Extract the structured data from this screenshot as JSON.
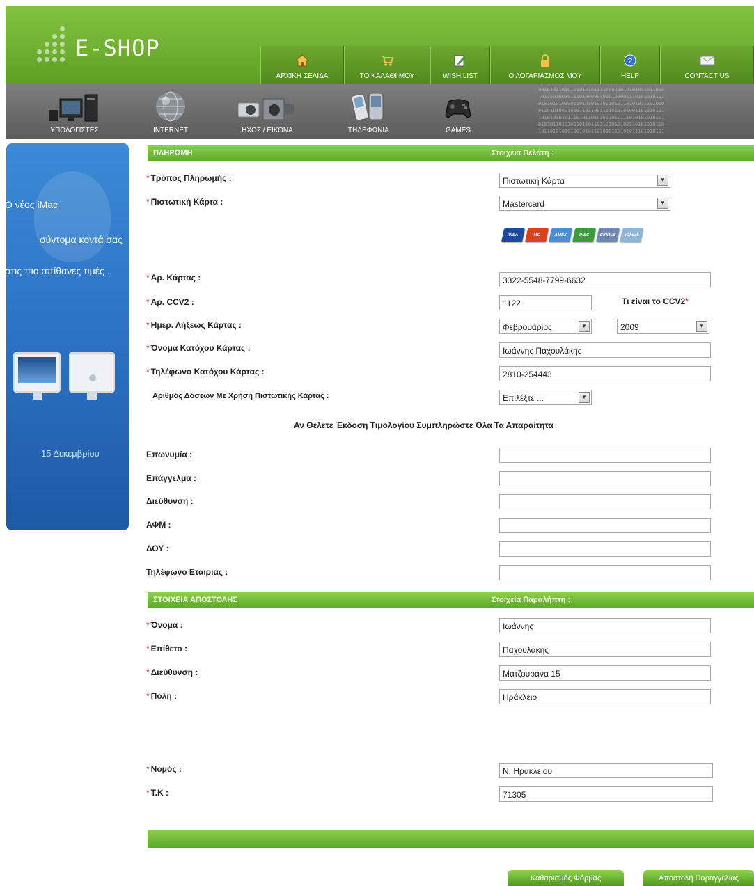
{
  "logo": {
    "text": "E-SHOP"
  },
  "top_nav": [
    {
      "label": "ΑΡΧΙΚΗ ΣΕΛΙΔΑ",
      "icon": "home-icon"
    },
    {
      "label": "ΤΟ ΚΑΛΑΘΙ ΜΟΥ",
      "icon": "cart-icon"
    },
    {
      "label": "WISH LIST",
      "icon": "edit-icon"
    },
    {
      "label": "Ο ΛΟΓΑΡΙΑΣΜΟΣ ΜΟΥ",
      "icon": "lock-icon"
    },
    {
      "label": "HELP",
      "icon": "help-icon"
    },
    {
      "label": "CONTACT US",
      "icon": "envelope-icon"
    }
  ],
  "categories": [
    {
      "label": "ΥΠΟΛΟΓΙΣΤΕΣ",
      "icon": "computer-icon"
    },
    {
      "label": "INTERNET",
      "icon": "globe-icon"
    },
    {
      "label": "ΗΧΟΣ / ΕΙΚΟΝΑ",
      "icon": "camera-icon"
    },
    {
      "label": "ΤΗΛΕΦΩΝΙΑ",
      "icon": "phone-icon"
    },
    {
      "label": "GAMES",
      "icon": "gamepad-icon"
    }
  ],
  "banner": {
    "line1": "Ο νέος iMac",
    "line2": "σύντομα κοντά σας",
    "line3": "στις πιο απίθανες τιμές .",
    "date": "15 Δεκεμβρίου"
  },
  "payment_section": {
    "title": "ΠΛΗΡΩΜΗ",
    "subtitle": "Στοιχεία Πελάτη :",
    "method_label": "Τρόπος Πληρωμής :",
    "method_value": "Πιστωτική Κάρτα",
    "card_label": "Πιστωτική Κάρτα :",
    "card_value": "Mastercard",
    "card_logos": [
      "VISA",
      "MC",
      "AMEX",
      "DISC",
      "CIRRUS",
      "eCheck"
    ],
    "card_number_label": "Αρ. Κάρτας :",
    "card_number_value": "3322-5548-7799-6632",
    "ccv_label": "Αρ. CCV2 :",
    "ccv_value": "1122",
    "ccv_help": "Τι είναι το CCV2",
    "expiry_label": "Ημερ. Λήξεως Κάρτας :",
    "expiry_month": "Φεβρουάριος",
    "expiry_year": "2009",
    "holder_name_label": "Όνομα Κατόχου Κάρτας :",
    "holder_name_value": "Ιωάννης Παχουλάκης",
    "holder_phone_label": "Τηλέφωνο Κατόχου Κάρτας :",
    "holder_phone_value": "2810-254443",
    "installments_label": "Αριθμός Δόσεων Με Χρήση Πιστωτικής Κάρτας :",
    "installments_value": "Επιλέξτε ..."
  },
  "invoice": {
    "note": "Αν Θέλετε Έκδοση Τιμολογίου Συμπληρώστε Όλα Τα Απαραίτητα",
    "company_label": "Επωνυμία :",
    "profession_label": "Επάγγελμα :",
    "address_label": "Διεύθυνση :",
    "vat_label": "ΑΦΜ :",
    "tax_office_label": "ΔΟΥ :",
    "phone_label": "Τηλέφωνο Εταιρίας :"
  },
  "shipping_section": {
    "title": "ΣΤΟΙΧΕΙΑ ΑΠΟΣΤΟΛΗΣ",
    "subtitle": "Στοιχεία Παραλήπτη :",
    "first_name_label": "Όνομα :",
    "first_name_value": "Ιωάννης",
    "last_name_label": "Επίθετο :",
    "last_name_value": "Παχουλάκης",
    "address_label": "Διεύθυνση :",
    "address_value": "Ματζουράνα 15",
    "city_label": "Πόλη :",
    "city_value": "Ηράκλειο",
    "prefecture_label": "Νομός :",
    "prefecture_value": "Ν. Ηρακλείου",
    "zip_label": "Τ.Κ :",
    "zip_value": "71305"
  },
  "buttons": {
    "clear": "Καθαρισμός Φόρμας",
    "submit": "Αποστολή Παραγγελίας"
  },
  "required_mark": "*",
  "colors": {
    "green": "#6fb130",
    "gray": "#6e6e6e",
    "blue": "#2c72c3",
    "required": "#d41b1b"
  }
}
